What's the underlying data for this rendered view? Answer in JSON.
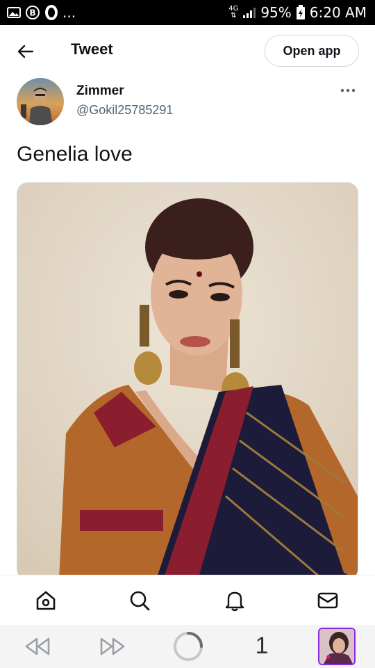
{
  "status_bar": {
    "left_icons": [
      "image-icon",
      "b-circle-icon",
      "o-icon"
    ],
    "ellipsis": "...",
    "network": "4G",
    "battery": "95%",
    "time": "6:20 AM"
  },
  "header": {
    "title": "Tweet",
    "open_app_label": "Open app"
  },
  "author": {
    "name": "Zimmer",
    "handle": "@Gokil25785291"
  },
  "tweet": {
    "text": "Genelia love"
  },
  "bottom_nav": {
    "items": [
      "home-icon",
      "search-icon",
      "notifications-icon",
      "messages-icon"
    ]
  },
  "browser_bar": {
    "tab_count": "1"
  },
  "colors": {
    "text_primary": "#0f1419",
    "text_secondary": "#536471",
    "border": "#cfd9de",
    "tab_thumb_border": "#8a2be2"
  }
}
